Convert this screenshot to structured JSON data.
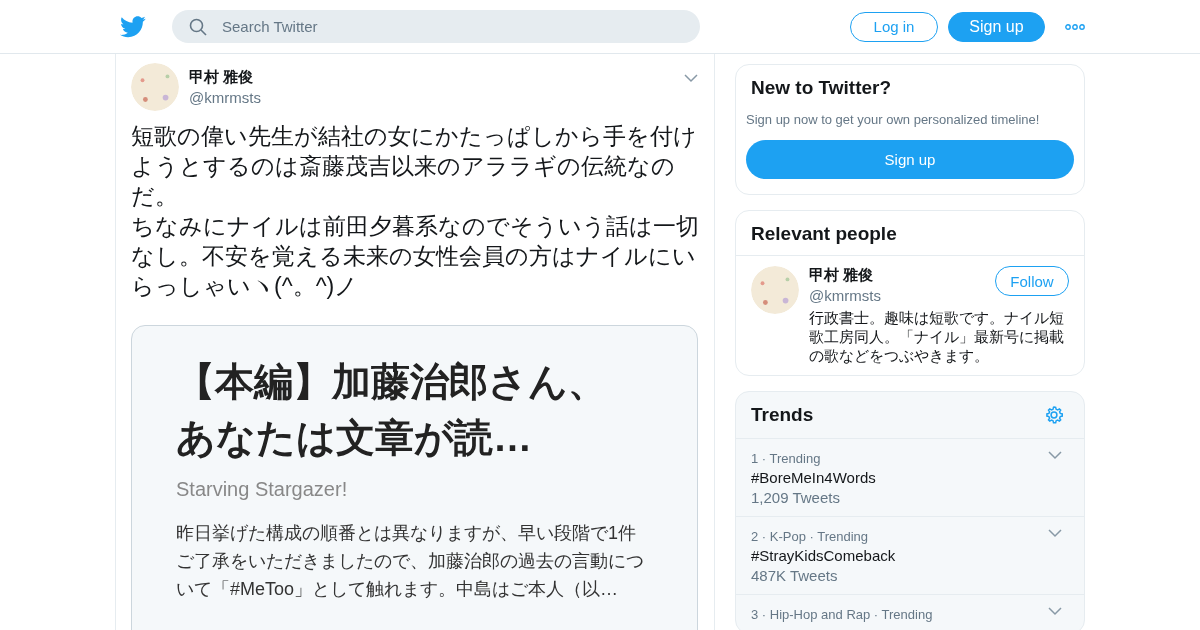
{
  "header": {
    "search": {
      "placeholder": "Search Twitter"
    },
    "login": "Log in",
    "signup": "Sign up"
  },
  "tweet": {
    "author": "甲村 雅俊",
    "handle": "@kmrmsts",
    "paragraphs": [
      "短歌の偉い先生が結社の女にかたっぱしから手を付けようとするのは斎藤茂吉以来のアララギの伝統なのだ。",
      "ちなみにナイルは前田夕暮系なのでそういう話は一切なし。不安を覚える未来の女性会員の方はナイルにいらっしゃいヽ(^。^)ノ"
    ],
    "card": {
      "title": "【本編】加藤治郎さん、あなたは文章が読…",
      "site": "Starving Stargazer!",
      "description": "昨日挙げた構成の順番とは異なりますが、早い段階で1件ご了承をいただきましたので、加藤治郎の過去の言動について「#MeToo」として触れます。中島はご本人（以…"
    }
  },
  "signup_box": {
    "title": "New to Twitter?",
    "subtitle": "Sign up now to get your own personalized timeline!",
    "button": "Sign up"
  },
  "relevant_people": {
    "title": "Relevant people",
    "people": [
      {
        "name": "甲村 雅俊",
        "handle": "@kmrmsts",
        "button": "Follow",
        "bio": "行政書士。趣味は短歌です。ナイル短歌工房同人。「ナイル」最新号に掲載の歌などをつぶやきます。"
      }
    ]
  },
  "trends": {
    "title": "Trends",
    "items": [
      {
        "meta": "1 · Trending",
        "name": "#BoreMeIn4Words",
        "count": "1,209 Tweets"
      },
      {
        "meta": "2 · K-Pop · Trending",
        "name": "#StrayKidsComeback",
        "count": "487K Tweets"
      },
      {
        "meta": "3 · Hip-Hop and Rap · Trending"
      }
    ]
  }
}
